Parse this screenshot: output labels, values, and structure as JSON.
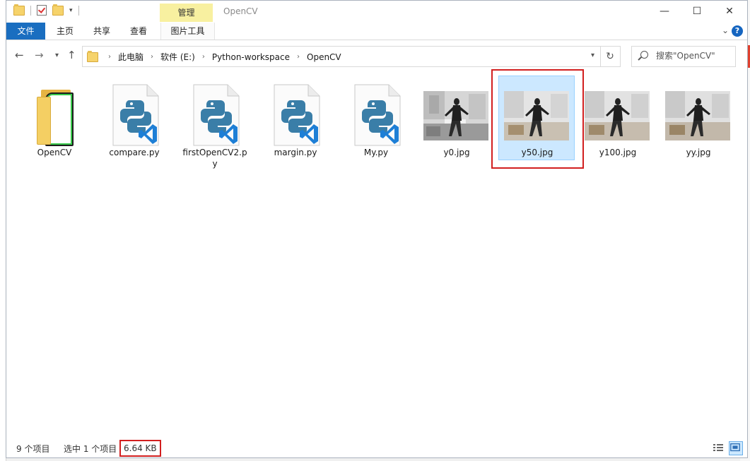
{
  "window": {
    "title": "OpenCV",
    "context_tab": "管理",
    "controls": {
      "minimize": "—",
      "maximize": "☐",
      "close": "✕"
    }
  },
  "ribbon": {
    "tabs": [
      "文件",
      "主页",
      "共享",
      "查看",
      "图片工具"
    ],
    "help": "?"
  },
  "nav": {
    "breadcrumb": [
      "此电脑",
      "软件 (E:)",
      "Python-workspace",
      "OpenCV"
    ],
    "search_placeholder": "搜索\"OpenCV\""
  },
  "files": [
    {
      "name": "OpenCV",
      "type": "folder"
    },
    {
      "name": "compare.py",
      "type": "py"
    },
    {
      "name": "firstOpenCV2.py",
      "type": "py"
    },
    {
      "name": "margin.py",
      "type": "py"
    },
    {
      "name": "My.py",
      "type": "py"
    },
    {
      "name": "y0.jpg",
      "type": "jpg"
    },
    {
      "name": "y50.jpg",
      "type": "jpg",
      "selected": true
    },
    {
      "name": "y100.jpg",
      "type": "jpg"
    },
    {
      "name": "yy.jpg",
      "type": "jpg"
    }
  ],
  "status": {
    "item_count": "9 个项目",
    "selected": "选中 1 个项目",
    "size": "6.64 KB"
  },
  "colors": {
    "file_tab": "#1a6ec0",
    "manage_tab": "#f8f0a0",
    "selection": "#cce8ff",
    "highlight": "#d21f1f",
    "python_blue": "#3a7ea8",
    "vscode_blue": "#1e7fd6"
  }
}
